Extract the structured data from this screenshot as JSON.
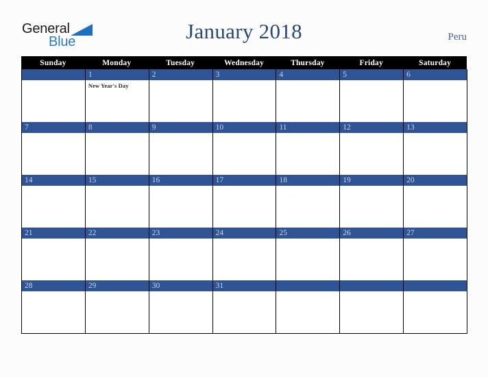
{
  "brand": {
    "line1": "General",
    "line2": "Blue",
    "triangle_color": "#1f6fc0",
    "line1_color": "#1a1a1a",
    "line2_color": "#2b7cc4"
  },
  "header": {
    "title": "January 2018",
    "title_color": "#2c4770",
    "country": "Peru",
    "country_color": "#4a5f85"
  },
  "calendar": {
    "month": "January",
    "year": "2018",
    "weekday_headers": [
      "Sunday",
      "Monday",
      "Tuesday",
      "Wednesday",
      "Thursday",
      "Friday",
      "Saturday"
    ],
    "header_background": "#000000",
    "header_text_color": "#ffffff",
    "day_band_color": "#2e5496",
    "day_number_color": "#ccd4e6",
    "cell_background": "#ffffff",
    "border_color": "#000000",
    "weeks": [
      {
        "days": [
          {
            "number": "",
            "event": ""
          },
          {
            "number": "1",
            "event": "New Year's Day"
          },
          {
            "number": "2",
            "event": ""
          },
          {
            "number": "3",
            "event": ""
          },
          {
            "number": "4",
            "event": ""
          },
          {
            "number": "5",
            "event": ""
          },
          {
            "number": "6",
            "event": ""
          }
        ]
      },
      {
        "days": [
          {
            "number": "7",
            "event": ""
          },
          {
            "number": "8",
            "event": ""
          },
          {
            "number": "9",
            "event": ""
          },
          {
            "number": "10",
            "event": ""
          },
          {
            "number": "11",
            "event": ""
          },
          {
            "number": "12",
            "event": ""
          },
          {
            "number": "13",
            "event": ""
          }
        ]
      },
      {
        "days": [
          {
            "number": "14",
            "event": ""
          },
          {
            "number": "15",
            "event": ""
          },
          {
            "number": "16",
            "event": ""
          },
          {
            "number": "17",
            "event": ""
          },
          {
            "number": "18",
            "event": ""
          },
          {
            "number": "19",
            "event": ""
          },
          {
            "number": "20",
            "event": ""
          }
        ]
      },
      {
        "days": [
          {
            "number": "21",
            "event": ""
          },
          {
            "number": "22",
            "event": ""
          },
          {
            "number": "23",
            "event": ""
          },
          {
            "number": "24",
            "event": ""
          },
          {
            "number": "25",
            "event": ""
          },
          {
            "number": "26",
            "event": ""
          },
          {
            "number": "27",
            "event": ""
          }
        ]
      },
      {
        "days": [
          {
            "number": "28",
            "event": ""
          },
          {
            "number": "29",
            "event": ""
          },
          {
            "number": "30",
            "event": ""
          },
          {
            "number": "31",
            "event": ""
          },
          {
            "number": "",
            "event": ""
          },
          {
            "number": "",
            "event": ""
          },
          {
            "number": "",
            "event": ""
          }
        ]
      }
    ]
  },
  "page": {
    "background": "#fcfcfd"
  }
}
